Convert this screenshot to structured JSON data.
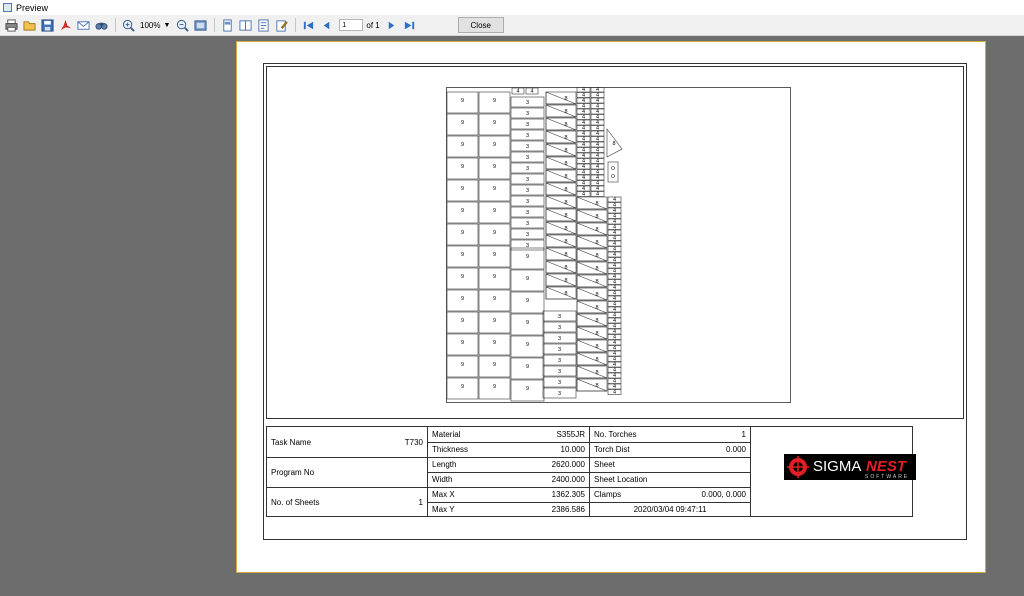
{
  "window": {
    "title": "Preview"
  },
  "toolbar": {
    "zoom_value": "100%",
    "page_current": "1",
    "page_total_label": "of 1",
    "close_label": "Close"
  },
  "info": {
    "task_name_label": "Task Name",
    "task_name_value": "T730",
    "program_no_label": "Program No",
    "program_no_value": "",
    "no_sheets_label": "No. of Sheets",
    "no_sheets_value": "1",
    "material_label": "Material",
    "material_value": "S355JR",
    "thickness_label": "Thickness",
    "thickness_value": "10.000",
    "length_label": "Length",
    "length_value": "2620.000",
    "width_label": "Width",
    "width_value": "2400.000",
    "maxx_label": "Max X",
    "maxx_value": "1362.305",
    "maxy_label": "Max Y",
    "maxy_value": "2386.586",
    "torches_label": "No. Torches",
    "torches_value": "1",
    "torch_dist_label": "Torch Dist",
    "torch_dist_value": "0.000",
    "sheet_label": "Sheet",
    "sheet_value": "",
    "sheet_location_label": "Sheet Location",
    "sheet_location_value": "",
    "clamps_label": "Clamps",
    "clamps_value": "0.000, 0.000",
    "datetime_value": "2020/03/04 09:47:11"
  },
  "logo": {
    "main_a": "SIGMA",
    "main_b": "NEST",
    "sub": "SOFTWARE"
  },
  "nest": {
    "part_labels": {
      "large": "9",
      "medium": "3",
      "triangle": "8",
      "small": "4"
    }
  },
  "colors": {
    "background": "#6d6d6d",
    "page_border": "#d4aa3a",
    "logo_red": "#e31e24"
  }
}
